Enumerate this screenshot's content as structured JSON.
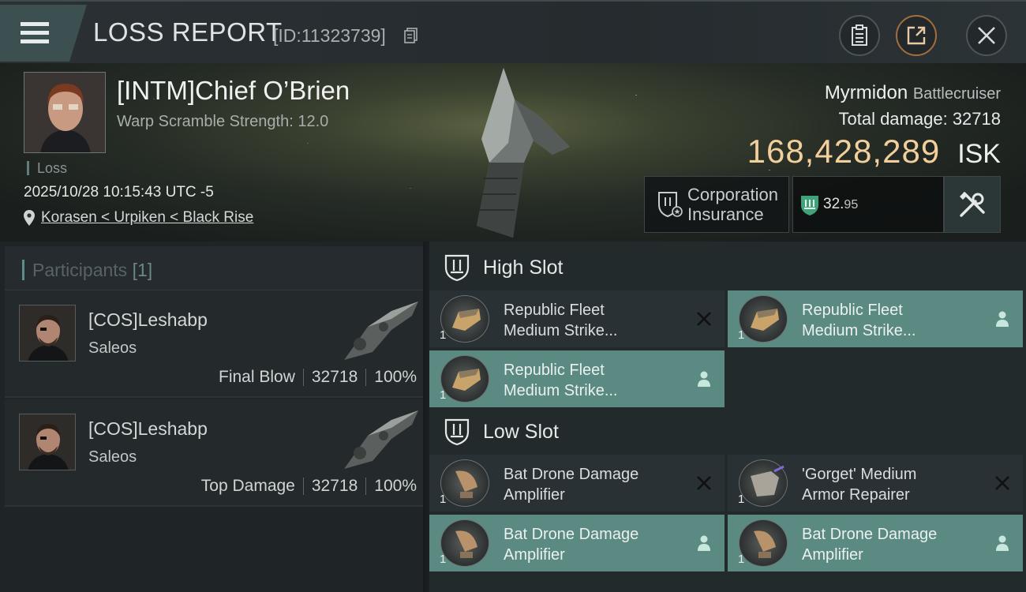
{
  "header": {
    "title": "LOSS REPORT",
    "report_id": "[ID:11323739]"
  },
  "victim": {
    "name": "[INTM]Chief O’Brien",
    "warp_scramble": "Warp Scramble Strength: 12.0",
    "status": "Loss",
    "datetime": "2025/10/28 10:15:43 UTC -5",
    "location": "Korasen < Urpiken < Black Rise",
    "ship_name": "Myrmidon",
    "ship_class": "Battlecruiser",
    "total_damage_label": "Total damage:",
    "total_damage": "32718",
    "isk_value": "168,428,289",
    "isk_unit": "ISK",
    "insurance_line1": "Corporation",
    "insurance_line2": "Insurance",
    "security_main": "32.",
    "security_small": "95"
  },
  "participants": {
    "label": "Participants",
    "count": "[1]",
    "items": [
      {
        "name": "[COS]Leshabp",
        "ship": "Saleos",
        "role": "Final Blow",
        "damage": "32718",
        "percent": "100%"
      },
      {
        "name": "[COS]Leshabp",
        "ship": "Saleos",
        "role": "Top Damage",
        "damage": "32718",
        "percent": "100%"
      }
    ]
  },
  "slots": {
    "high_label": "High Slot",
    "low_label": "Low Slot",
    "high": [
      {
        "line1": "Republic Fleet",
        "line2": "Medium Strike...",
        "qty": "1",
        "state": "destroyed"
      },
      {
        "line1": "Republic Fleet",
        "line2": "Medium Strike...",
        "qty": "1",
        "state": "dropped"
      },
      {
        "line1": "Republic Fleet",
        "line2": "Medium Strike...",
        "qty": "1",
        "state": "dropped"
      }
    ],
    "low": [
      {
        "line1": "Bat Drone Damage",
        "line2": "Amplifier",
        "qty": "1",
        "state": "destroyed"
      },
      {
        "line1": "'Gorget' Medium",
        "line2": "Armor Repairer",
        "qty": "1",
        "state": "destroyed"
      },
      {
        "line1": "Bat Drone Damage",
        "line2": "Amplifier",
        "qty": "1",
        "state": "dropped"
      },
      {
        "line1": "Bat Drone Damage",
        "line2": "Amplifier",
        "qty": "1",
        "state": "dropped"
      }
    ]
  },
  "colors": {
    "accent_teal": "#5b8a83",
    "isk_gold": "#f2cf9b",
    "panel_dark": "#2a3134"
  },
  "icons": [
    "menu-icon",
    "copy-icon",
    "clipboard-icon",
    "share-icon",
    "close-icon",
    "location-pin-icon",
    "insurance-shield-icon",
    "security-shield-icon",
    "wrench-icon",
    "slot-shield-icon",
    "destroyed-x-icon",
    "dropped-person-icon"
  ]
}
